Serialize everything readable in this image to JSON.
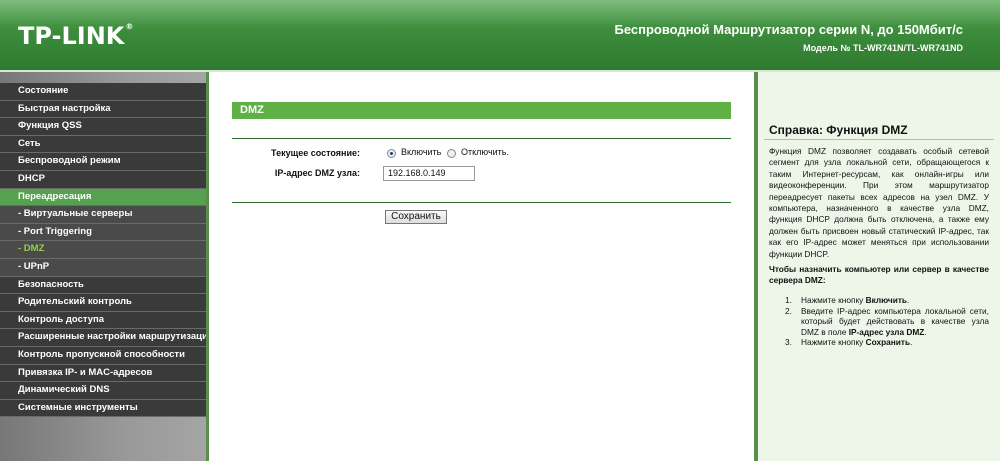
{
  "header": {
    "logo": "TP-LINK",
    "logo_mark": "®",
    "product_title": "Беспроводной Маршрутизатор серии N, до 150Мбит/с",
    "model": "Модель № TL-WR741N/TL-WR741ND"
  },
  "sidebar": {
    "items": [
      {
        "label": "Состояние"
      },
      {
        "label": "Быстрая настройка"
      },
      {
        "label": "Функция QSS"
      },
      {
        "label": "Сеть"
      },
      {
        "label": "Беспроводной режим"
      },
      {
        "label": "DHCP"
      },
      {
        "label": "Переадресация"
      },
      {
        "label": "- Виртуальные серверы"
      },
      {
        "label": "- Port Triggering"
      },
      {
        "label": "- DMZ"
      },
      {
        "label": "- UPnP"
      },
      {
        "label": "Безопасность"
      },
      {
        "label": "Родительский контроль"
      },
      {
        "label": "Контроль доступа"
      },
      {
        "label": "Расширенные настройки маршрутизации"
      },
      {
        "label": "Контроль пропускной способности"
      },
      {
        "label": "Привязка IP- и MAC-адресов"
      },
      {
        "label": "Динамический DNS"
      },
      {
        "label": "Системные инструменты"
      }
    ]
  },
  "main": {
    "section_title": "DMZ",
    "status_label": "Текущее состояние:",
    "enable_label": "Включить",
    "disable_label": "Отключить.",
    "enabled": true,
    "ip_label": "IP-адрес DMZ узла:",
    "ip_value": "192.168.0.149",
    "save_label": "Сохранить"
  },
  "help": {
    "title": "Справка: Функция DMZ",
    "p1": "Функция DMZ позволяет создавать особый сетевой сегмент для узла локальной сети, обращающегося к таким Интернет-ресурсам, как онлайн-игры или видеоконференции. При этом маршрутизатор переадресует пакеты всех адресов на узел DMZ. У компьютера, назначенного в качестве узла DMZ, функция DHCP должна быть отключена, а также ему должен быть присвоен новый статический IP-адрес, так как его IP-адрес может меняться при использовании функции DHCP.",
    "p2": "Чтобы назначить компьютер или сервер в качестве сервера DMZ:",
    "steps": [
      {
        "num": "1.",
        "pre": "Нажмите кнопку ",
        "bold": "Включить",
        "post": "."
      },
      {
        "num": "2.",
        "pre": "Введите IP-адрес компьютера локальной сети, который будет действовать в качестве узла DMZ в поле ",
        "bold": "IP-адрес узла DMZ",
        "post": "."
      },
      {
        "num": "3.",
        "pre": "Нажмите кнопку ",
        "bold": "Сохранить",
        "post": "."
      }
    ]
  },
  "colors": {
    "brand_green": "#3c8c3c",
    "menu_active": "#56a14f",
    "menu_current_text": "#8fd14f",
    "section_bar": "#5fb045"
  }
}
